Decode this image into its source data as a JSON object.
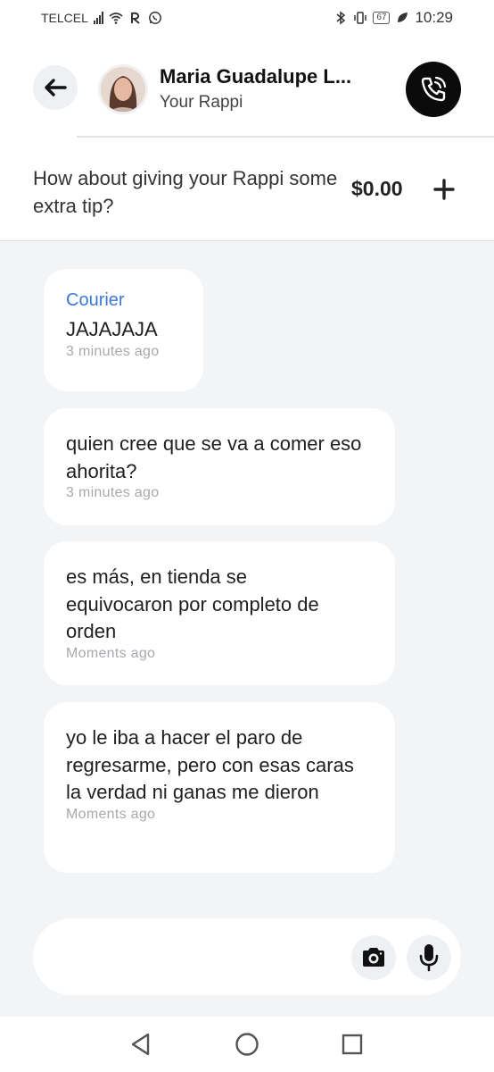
{
  "status_bar": {
    "carrier": "TELCEL",
    "battery": "67",
    "time": "10:29",
    "icons": [
      "signal-icon",
      "wifi-icon",
      "rappi-icon",
      "whatsapp-icon",
      "bluetooth-icon",
      "vibrate-icon",
      "battery-icon",
      "leaf-icon"
    ]
  },
  "header": {
    "name": "Maria Guadalupe L...",
    "subtitle": "Your Rappi"
  },
  "tip": {
    "text": "How about giving your Rappi some extra tip?",
    "amount": "$0.00"
  },
  "messages": [
    {
      "label": "Courier",
      "text": "JAJAJAJA",
      "time": "3 minutes ago"
    },
    {
      "label": "",
      "text": "quien cree que se va a comer eso ahorita?",
      "time": "3 minutes ago"
    },
    {
      "label": "",
      "text": "es más, en tienda se equivocaron por completo de orden",
      "time": "Moments ago"
    },
    {
      "label": "",
      "text": "yo le iba a hacer el paro de regresarme, pero con esas caras la verdad ni ganas me dieron",
      "time": "Moments ago"
    }
  ],
  "composer": {
    "placeholder": ""
  },
  "colors": {
    "background": "#f3f4f6",
    "bubble": "#ffffff",
    "courier_label": "#3b78d8",
    "call_button": "#0b0b0b"
  }
}
